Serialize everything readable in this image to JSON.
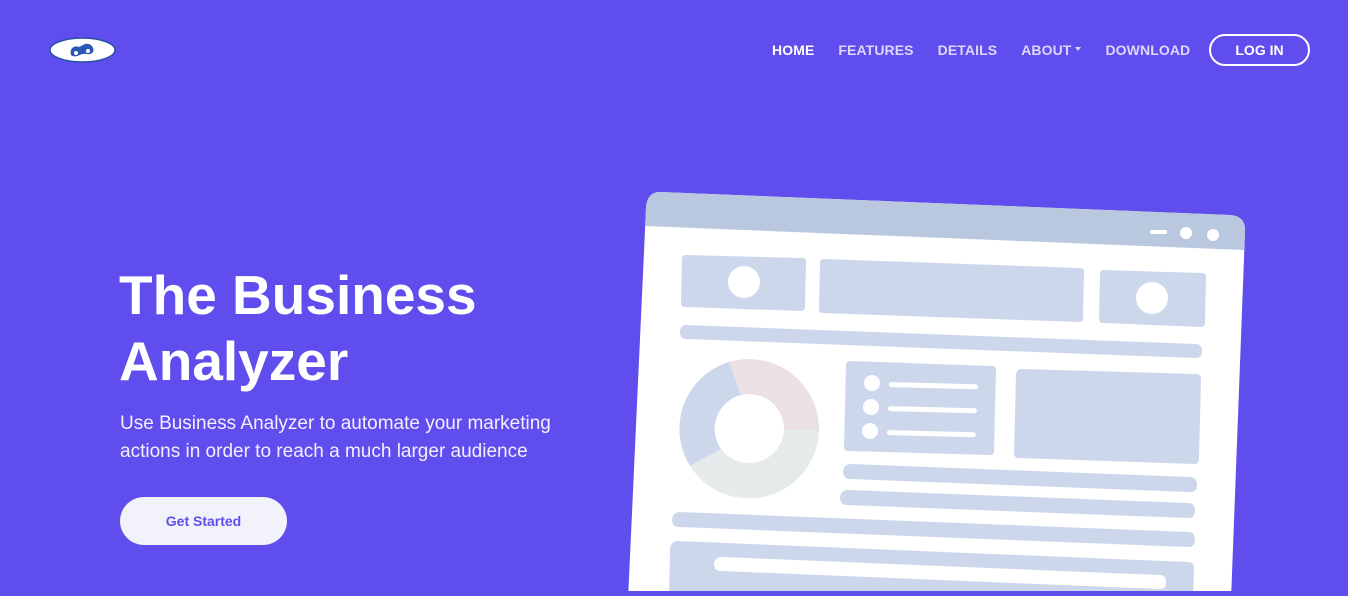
{
  "brand": {
    "logo_icon": "bicycle-logo-icon"
  },
  "nav": {
    "items": [
      {
        "label": "HOME",
        "active": true
      },
      {
        "label": "FEATURES",
        "active": false
      },
      {
        "label": "DETAILS",
        "active": false
      },
      {
        "label": "ABOUT",
        "active": false,
        "has_dropdown": true
      },
      {
        "label": "DOWNLOAD",
        "active": false
      }
    ],
    "login_label": "LOG IN"
  },
  "hero": {
    "title": "The Business Analyzer",
    "subtitle": "Use Business Analyzer to automate your marketing actions in order to reach a much larger audience",
    "cta_label": "Get Started"
  },
  "colors": {
    "background": "#5f4dee",
    "text": "#ffffff",
    "cta_background": "#f2f2fb",
    "cta_text": "#5f4dee",
    "illustration_panel": "#cdd7ec",
    "illustration_titlebar": "#b8c8e0"
  }
}
